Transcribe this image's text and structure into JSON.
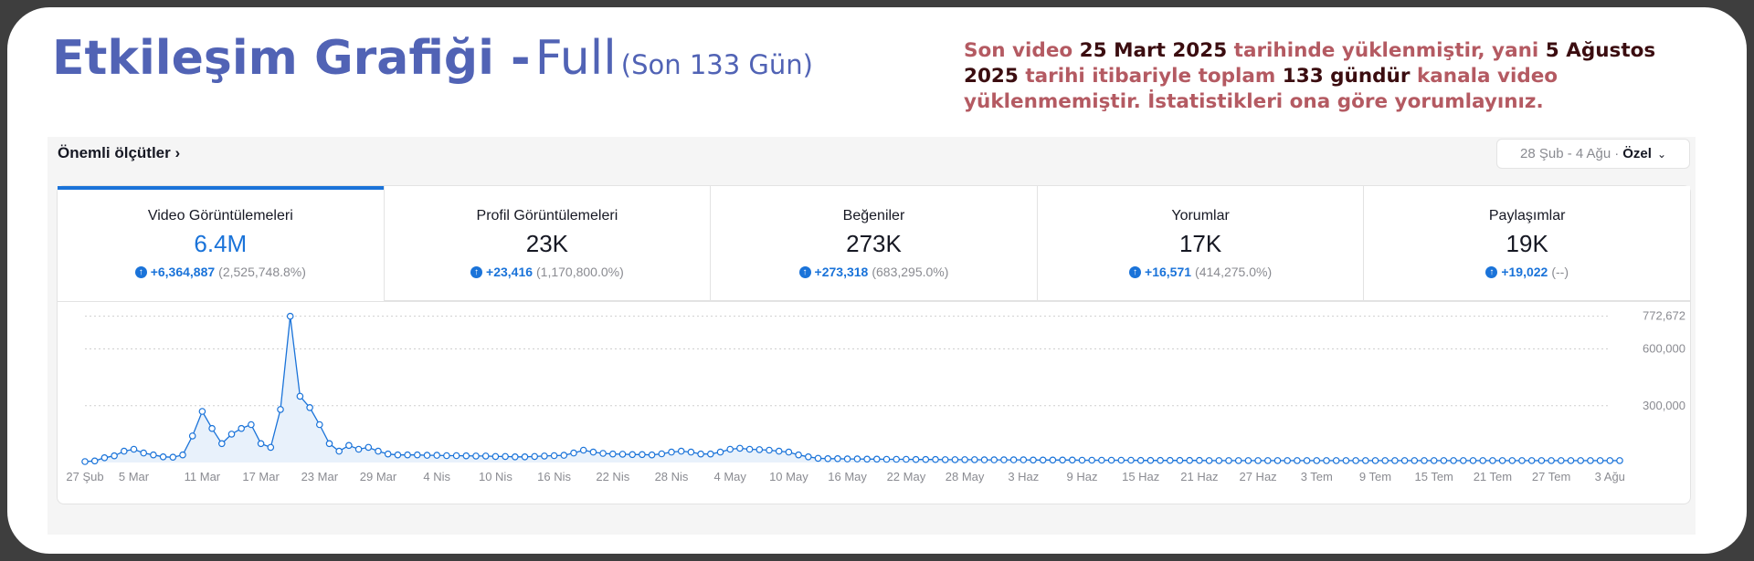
{
  "header": {
    "title_bold": "Etkileşim Grafiği -",
    "title_light": "Full",
    "title_range": "(Son 133 Gün)"
  },
  "notice": {
    "p1": "Son video ",
    "d1": "25 Mart 2025",
    "p2": " tarihinde yüklenmiştir, yani ",
    "d2": "5 Ağustos 2025",
    "p3": " tarihi itibariyle toplam ",
    "d3": "133 gündür",
    "p4": " kanala video yüklenmemiştir. İstatistikleri ona göre yorumlayınız."
  },
  "panel": {
    "metrics_link": "Önemli ölçütler ›",
    "date_range": "28 Şub - 4 Ağu",
    "date_sep": "·",
    "date_mode": "Özel",
    "chevron": "⌄"
  },
  "tabs": [
    {
      "label": "Video Görüntülemeleri",
      "value": "6.4M",
      "delta": "+6,364,887",
      "pct": "(2,525,748.8%)"
    },
    {
      "label": "Profil Görüntülemeleri",
      "value": "23K",
      "delta": "+23,416",
      "pct": "(1,170,800.0%)"
    },
    {
      "label": "Beğeniler",
      "value": "273K",
      "delta": "+273,318",
      "pct": "(683,295.0%)"
    },
    {
      "label": "Yorumlar",
      "value": "17K",
      "delta": "+16,571",
      "pct": "(414,275.0%)"
    },
    {
      "label": "Paylaşımlar",
      "value": "19K",
      "delta": "+19,022",
      "pct": "(--)"
    }
  ],
  "colors": {
    "accent": "#1a73d9",
    "title": "#5163b5",
    "notice": "#b45a62",
    "notice_dark": "#3b0d10"
  },
  "icons": {
    "trend": "arrow-up-circle-icon"
  },
  "chart_data": {
    "type": "line",
    "title": "",
    "xlabel": "",
    "ylabel": "",
    "ylim": [
      0,
      800000
    ],
    "y_ticks": [
      300000,
      600000,
      772672
    ],
    "y_tick_labels": [
      "300,000",
      "600,000",
      "772,672"
    ],
    "grid": true,
    "x_tick_labels": [
      "27 Şub",
      "5 Mar",
      "11 Mar",
      "17 Mar",
      "23 Mar",
      "29 Mar",
      "4 Nis",
      "10 Nis",
      "16 Nis",
      "22 Nis",
      "28 Nis",
      "4 May",
      "10 May",
      "16 May",
      "22 May",
      "28 May",
      "3 Haz",
      "9 Haz",
      "15 Haz",
      "21 Haz",
      "27 Haz",
      "3 Tem",
      "9 Tem",
      "15 Tem",
      "21 Tem",
      "27 Tem",
      "3 Ağu"
    ],
    "x_tick_index": [
      0,
      5,
      12,
      18,
      24,
      30,
      36,
      42,
      48,
      54,
      60,
      66,
      72,
      78,
      84,
      90,
      96,
      102,
      108,
      114,
      120,
      126,
      132,
      138,
      144,
      150,
      156
    ],
    "series": [
      {
        "values": [
          5000,
          8000,
          25000,
          35000,
          60000,
          70000,
          50000,
          40000,
          30000,
          28000,
          40000,
          140000,
          270000,
          180000,
          100000,
          150000,
          180000,
          200000,
          100000,
          80000,
          280000,
          772672,
          350000,
          290000,
          200000,
          100000,
          60000,
          90000,
          70000,
          80000,
          60000,
          45000,
          40000,
          40000,
          40000,
          38000,
          38000,
          36000,
          36000,
          35000,
          34000,
          34000,
          32000,
          32000,
          30000,
          30000,
          32000,
          34000,
          36000,
          38000,
          50000,
          65000,
          55000,
          48000,
          45000,
          44000,
          42000,
          42000,
          40000,
          46000,
          55000,
          60000,
          55000,
          45000,
          45000,
          55000,
          70000,
          75000,
          70000,
          68000,
          65000,
          60000,
          55000,
          40000,
          30000,
          22000,
          20000,
          20000,
          19000,
          19000,
          18000,
          18000,
          17000,
          17000,
          17000,
          16000,
          16000,
          16000,
          15000,
          15000,
          15000,
          15000,
          14000,
          14000,
          14000,
          14000,
          14000,
          13000,
          13000,
          13000,
          13000,
          13000,
          12000,
          12000,
          12000,
          12000,
          12000,
          12000,
          11000,
          11000,
          11000,
          11000,
          11000,
          11000,
          11000,
          10000,
          10000,
          10000,
          10000,
          10000,
          10000,
          10000,
          10000,
          10000,
          10000,
          10000,
          10000,
          10000,
          10000,
          10000,
          10000,
          10000,
          10000,
          10000,
          10000,
          10000,
          10000,
          10000,
          10000,
          10000,
          10000,
          10000,
          10000,
          10000,
          10000,
          10000,
          10000,
          10000,
          10000,
          10000,
          10000,
          10000,
          10000,
          10000,
          10000,
          10000,
          10000,
          10000
        ]
      }
    ]
  }
}
